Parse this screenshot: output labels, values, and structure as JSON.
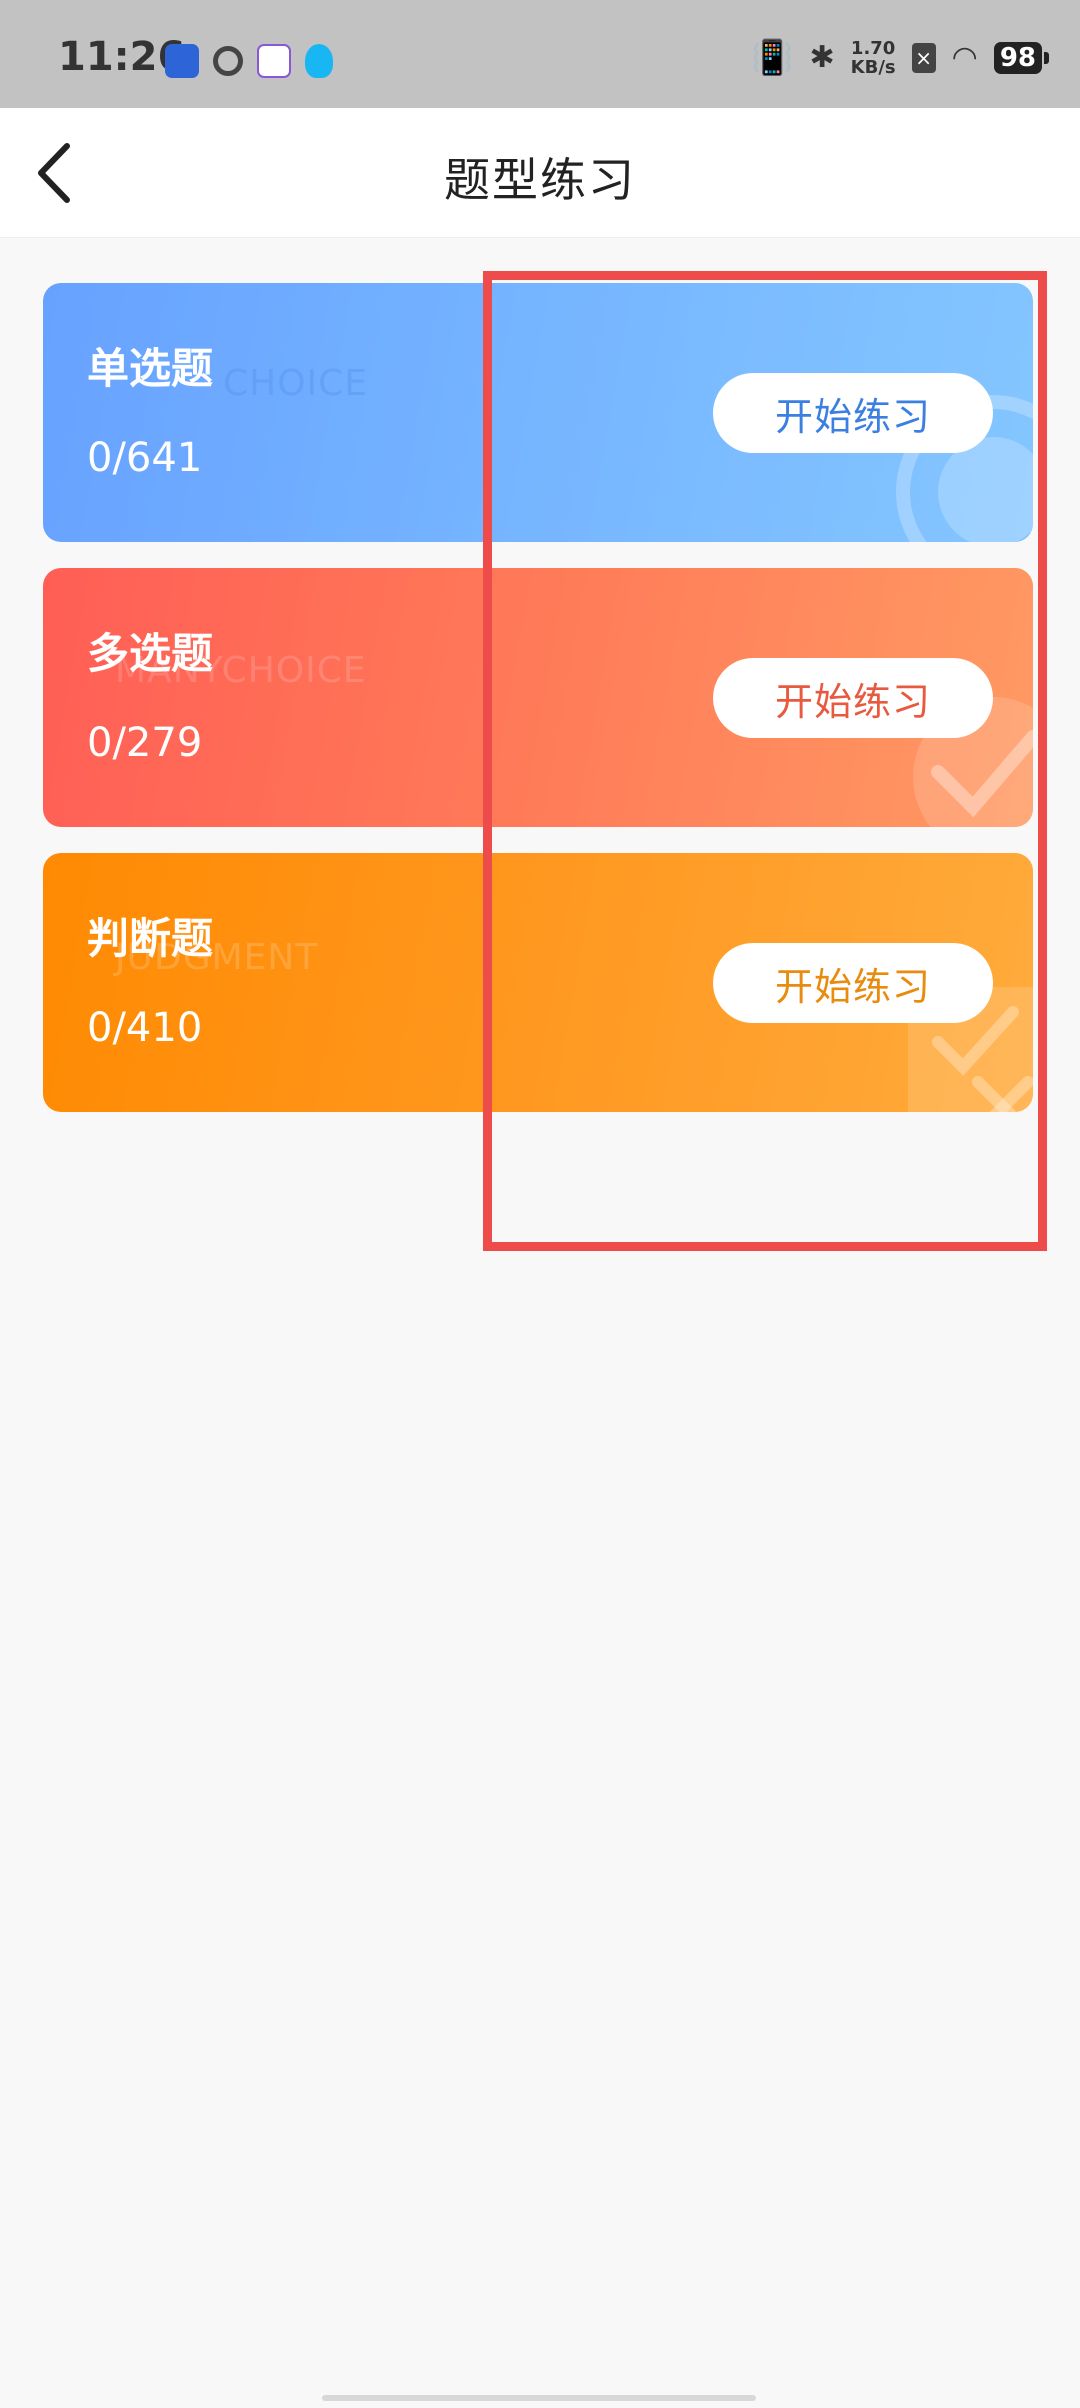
{
  "status_bar": {
    "time": "11:26",
    "net_speed_value": "1.70",
    "net_speed_unit": "KB/s",
    "battery": "98"
  },
  "header": {
    "title": "题型练习"
  },
  "cards": [
    {
      "title": "单选题",
      "watermark": "CHOICE",
      "count": "0/641",
      "button": "开始练习",
      "color": "#67a2ff"
    },
    {
      "title": "多选题",
      "watermark": "MANYCHOICE",
      "count": "0/279",
      "button": "开始练习",
      "color": "#ff6a56"
    },
    {
      "title": "判断题",
      "watermark": "JUDGMENT",
      "count": "0/410",
      "button": "开始练习",
      "color": "#ff8f0a"
    }
  ],
  "annotation_color": "#ee4b4b"
}
